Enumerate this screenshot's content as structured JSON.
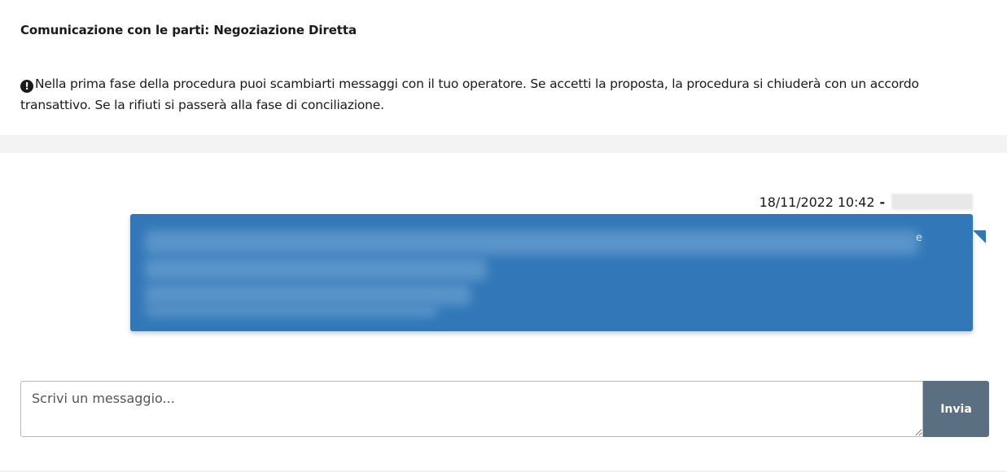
{
  "header": {
    "title": "Comunicazione con le parti: Negoziazione Diretta",
    "info_icon": "exclamation-circle-icon",
    "info_text": "Nella prima fase della procedura puoi scambiarti messaggi con il tuo operatore. Se accetti la proposta, la procedura si chiuderà con un accordo transattivo. Se la rifiuti si passerà alla fase di conciliazione."
  },
  "messages": [
    {
      "timestamp": "18/11/2022 10:42",
      "separator": "-",
      "sender_redacted": true,
      "body_redacted": true,
      "bubble_color": "#3278b8",
      "visible_fragment": "e"
    }
  ],
  "composer": {
    "placeholder": "Scrivi un messaggio...",
    "send_label": "Invia",
    "send_color": "#5b6f82"
  }
}
